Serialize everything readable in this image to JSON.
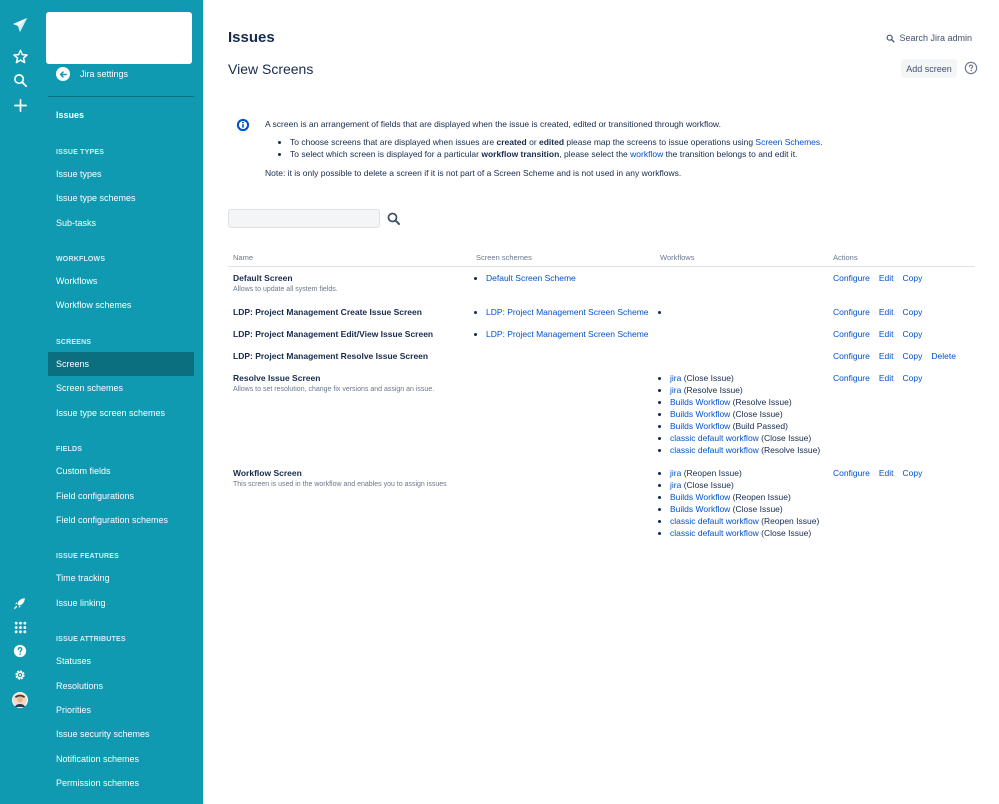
{
  "colors": {
    "sidebar": "#0f9ab1",
    "active": "#0b6f80",
    "link": "#0052cc"
  },
  "icons": {
    "global": [
      "jira-logo-icon",
      "star-icon",
      "search-icon",
      "plus-icon",
      "rocket-icon",
      "apps-grid-icon",
      "help-icon",
      "gear-icon",
      "avatar"
    ],
    "back": "arrow-left-icon",
    "info": "info-icon",
    "filter": "search-icon"
  },
  "sidebar": {
    "back_label": "Jira settings",
    "current_item": "Issues",
    "sections": [
      {
        "heading": "ISSUE TYPES",
        "items": [
          "Issue types",
          "Issue type schemes",
          "Sub-tasks"
        ]
      },
      {
        "heading": "WORKFLOWS",
        "items": [
          "Workflows",
          "Workflow schemes"
        ]
      },
      {
        "heading": "SCREENS",
        "items": [
          "Screens",
          "Screen schemes",
          "Issue type screen schemes"
        ]
      },
      {
        "heading": "FIELDS",
        "items": [
          "Custom fields",
          "Field configurations",
          "Field configuration schemes"
        ]
      },
      {
        "heading": "ISSUE FEATURES",
        "items": [
          "Time tracking",
          "Issue linking"
        ]
      },
      {
        "heading": "ISSUE ATTRIBUTES",
        "items": [
          "Statuses",
          "Resolutions",
          "Priorities",
          "Issue security schemes",
          "Notification schemes",
          "Permission schemes"
        ]
      }
    ],
    "active_item": "Screens"
  },
  "header": {
    "title": "Issues",
    "search_admin": "Search Jira admin",
    "page_title": "View Screens",
    "add_button": "Add screen"
  },
  "info": {
    "intro": "A screen is an arrangement of fields that are displayed when the issue is created, edited or transitioned through workflow.",
    "bullet1": {
      "a": "To choose screens that are displayed when issues are ",
      "b1": "created",
      "c": " or ",
      "b2": "edited",
      "d": " please map the screens to issue operations using ",
      "link": "Screen Schemes",
      "e": "."
    },
    "bullet2": {
      "a": "To select which screen is displayed for a particular ",
      "b": "workflow transition",
      "c": ", please select the ",
      "link": "workflow",
      "d": " the transition belongs to and edit it."
    },
    "note": "Note: it is only possible to delete a screen if it is not part of a Screen Scheme and is not used in any workflows."
  },
  "filter": {
    "value": "",
    "placeholder": ""
  },
  "table": {
    "headers": {
      "name": "Name",
      "schemes": "Screen schemes",
      "workflows": "Workflows",
      "actions": "Actions"
    },
    "rows": [
      {
        "name": "Default Screen",
        "desc": "Allows to update all system fields.",
        "schemes": [
          "Default Screen Scheme"
        ],
        "workflows": [],
        "actions": [
          "Configure",
          "Edit",
          "Copy"
        ]
      },
      {
        "name": "LDP: Project Management Create Issue Screen",
        "desc": "",
        "schemes": [
          "LDP: Project Management Screen Scheme"
        ],
        "workflows": [
          {
            "link": "",
            "text": ""
          }
        ],
        "actions": [
          "Configure",
          "Edit",
          "Copy"
        ]
      },
      {
        "name": "LDP: Project Management Edit/View Issue Screen",
        "desc": "",
        "schemes": [
          "LDP: Project Management Screen Scheme"
        ],
        "workflows": [],
        "actions": [
          "Configure",
          "Edit",
          "Copy"
        ]
      },
      {
        "name": "LDP: Project Management Resolve Issue Screen",
        "desc": "",
        "schemes": [],
        "workflows": [],
        "actions": [
          "Configure",
          "Edit",
          "Copy",
          "Delete"
        ]
      },
      {
        "name": "Resolve Issue Screen",
        "desc": "Allows to set resolution, change fix versions and assign an issue.",
        "schemes": [],
        "workflows": [
          {
            "link": "jira",
            "text": " (Close Issue)"
          },
          {
            "link": "jira",
            "text": " (Resolve Issue)"
          },
          {
            "link": "Builds Workflow",
            "text": " (Resolve Issue)"
          },
          {
            "link": "Builds Workflow",
            "text": " (Close Issue)"
          },
          {
            "link": "Builds Workflow",
            "text": " (Build Passed)"
          },
          {
            "link": "classic default workflow",
            "text": " (Close Issue)"
          },
          {
            "link": "classic default workflow",
            "text": " (Resolve Issue)"
          }
        ],
        "actions": [
          "Configure",
          "Edit",
          "Copy"
        ]
      },
      {
        "name": "Workflow Screen",
        "desc": "This screen is used in the workflow and enables you to assign issues",
        "schemes": [],
        "workflows": [
          {
            "link": "jira",
            "text": " (Reopen Issue)"
          },
          {
            "link": "jira",
            "text": " (Close Issue)"
          },
          {
            "link": "Builds Workflow",
            "text": " (Reopen Issue)"
          },
          {
            "link": "Builds Workflow",
            "text": " (Close Issue)"
          },
          {
            "link": "classic default workflow",
            "text": " (Reopen Issue)"
          },
          {
            "link": "classic default workflow",
            "text": " (Close Issue)"
          }
        ],
        "actions": [
          "Configure",
          "Edit",
          "Copy"
        ]
      }
    ]
  }
}
